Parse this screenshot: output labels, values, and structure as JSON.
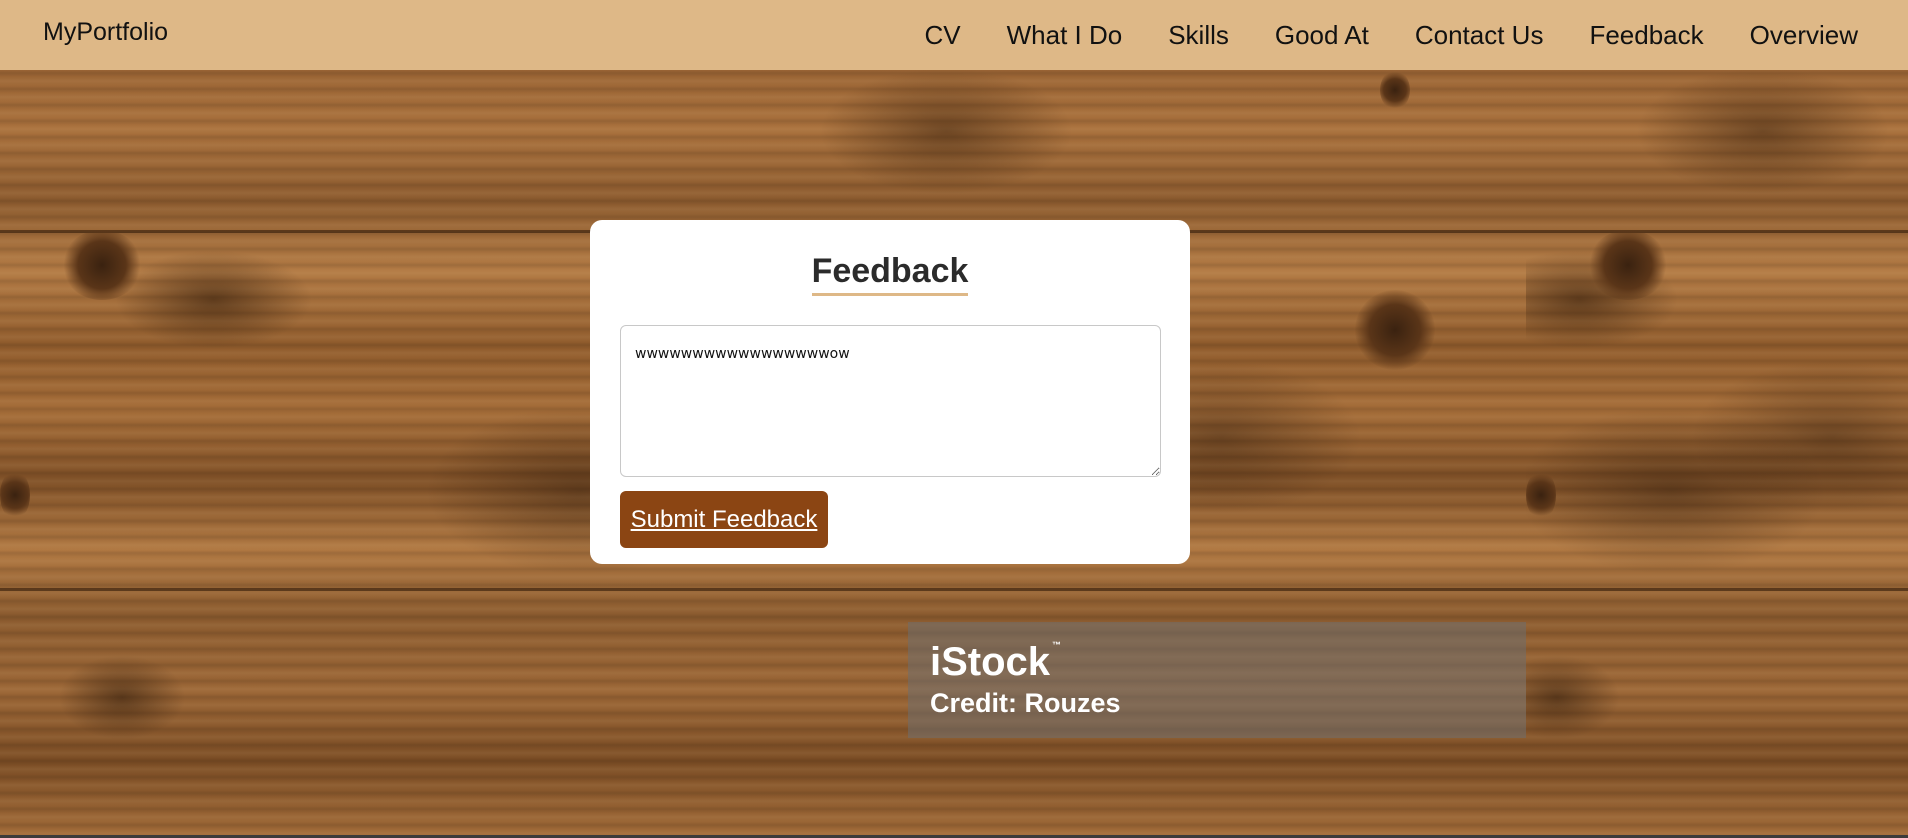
{
  "nav": {
    "brand": "MyPortfolio",
    "links": [
      "CV",
      "What I Do",
      "Skills",
      "Good At",
      "Contact Us",
      "Feedback",
      "Overview"
    ]
  },
  "feedback_card": {
    "title": "Feedback",
    "textarea_value": "wwwwwwwwwwwwwwwwwow",
    "submit_label": "Submit Feedback"
  },
  "watermark": {
    "logo": "iStock",
    "trademark": "™",
    "credit": "Credit: Rouzes"
  },
  "colors": {
    "navbar_bg": "#deb887",
    "accent_underline": "#deb887",
    "button_bg": "#8b4513",
    "card_bg": "#ffffff"
  },
  "icons": {
    "textarea_resize": "resize-handle-icon"
  }
}
